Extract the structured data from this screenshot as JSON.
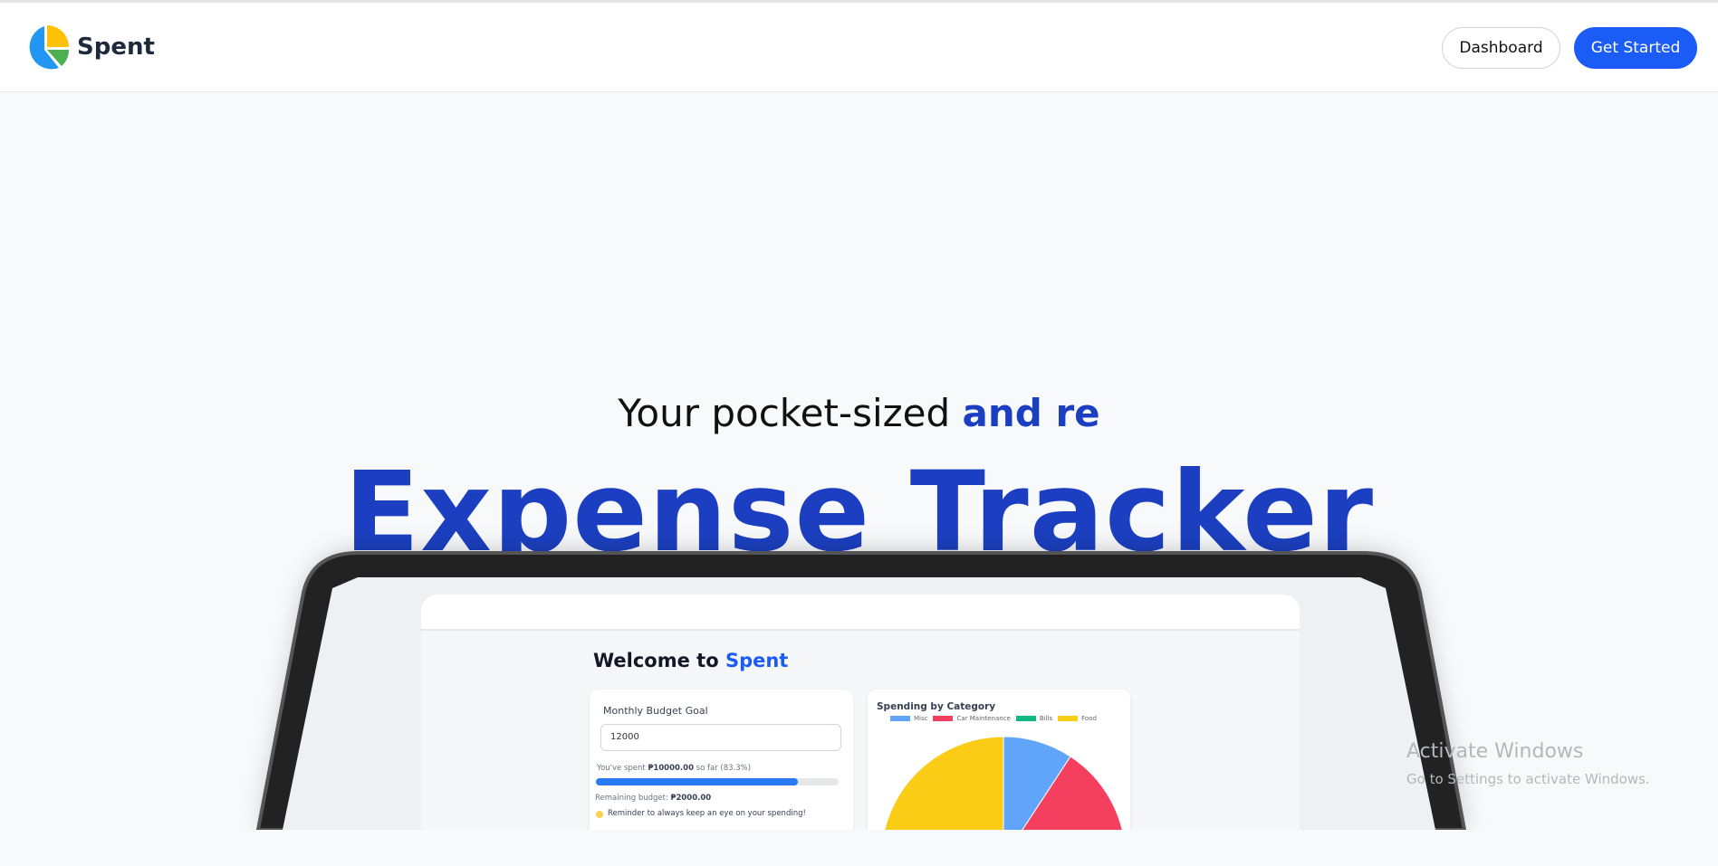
{
  "nav": {
    "brand": "Spent",
    "dashboard": "Dashboard",
    "get_started": "Get Started"
  },
  "hero": {
    "tagline_plain": "Your pocket-sized ",
    "tagline_highlight": "and re",
    "title": "Expense Tracker"
  },
  "preview": {
    "welcome_prefix": "Welcome to ",
    "welcome_brand": "Spent",
    "budget": {
      "title": "Monthly Budget Goal",
      "value": "12000",
      "spent_prefix": "You've spent ",
      "spent_amount": "₱10000.00",
      "spent_suffix": " so far (83.3%)",
      "progress_percent": 83.3,
      "remaining_label": "Remaining budget: ",
      "remaining_amount": "₱2000.00",
      "reminder": "Reminder to always keep an eye on your spending!"
    },
    "chart": {
      "title": "Spending by Category",
      "legend": [
        {
          "label": "Misc",
          "color": "#60a5fa"
        },
        {
          "label": "Car Maintenance",
          "color": "#f43f5e"
        },
        {
          "label": "Bills",
          "color": "#10b981"
        },
        {
          "label": "Food",
          "color": "#facc15"
        }
      ]
    }
  },
  "watermark": {
    "line1": "Activate Windows",
    "line2": "Go to Settings to activate Windows."
  }
}
